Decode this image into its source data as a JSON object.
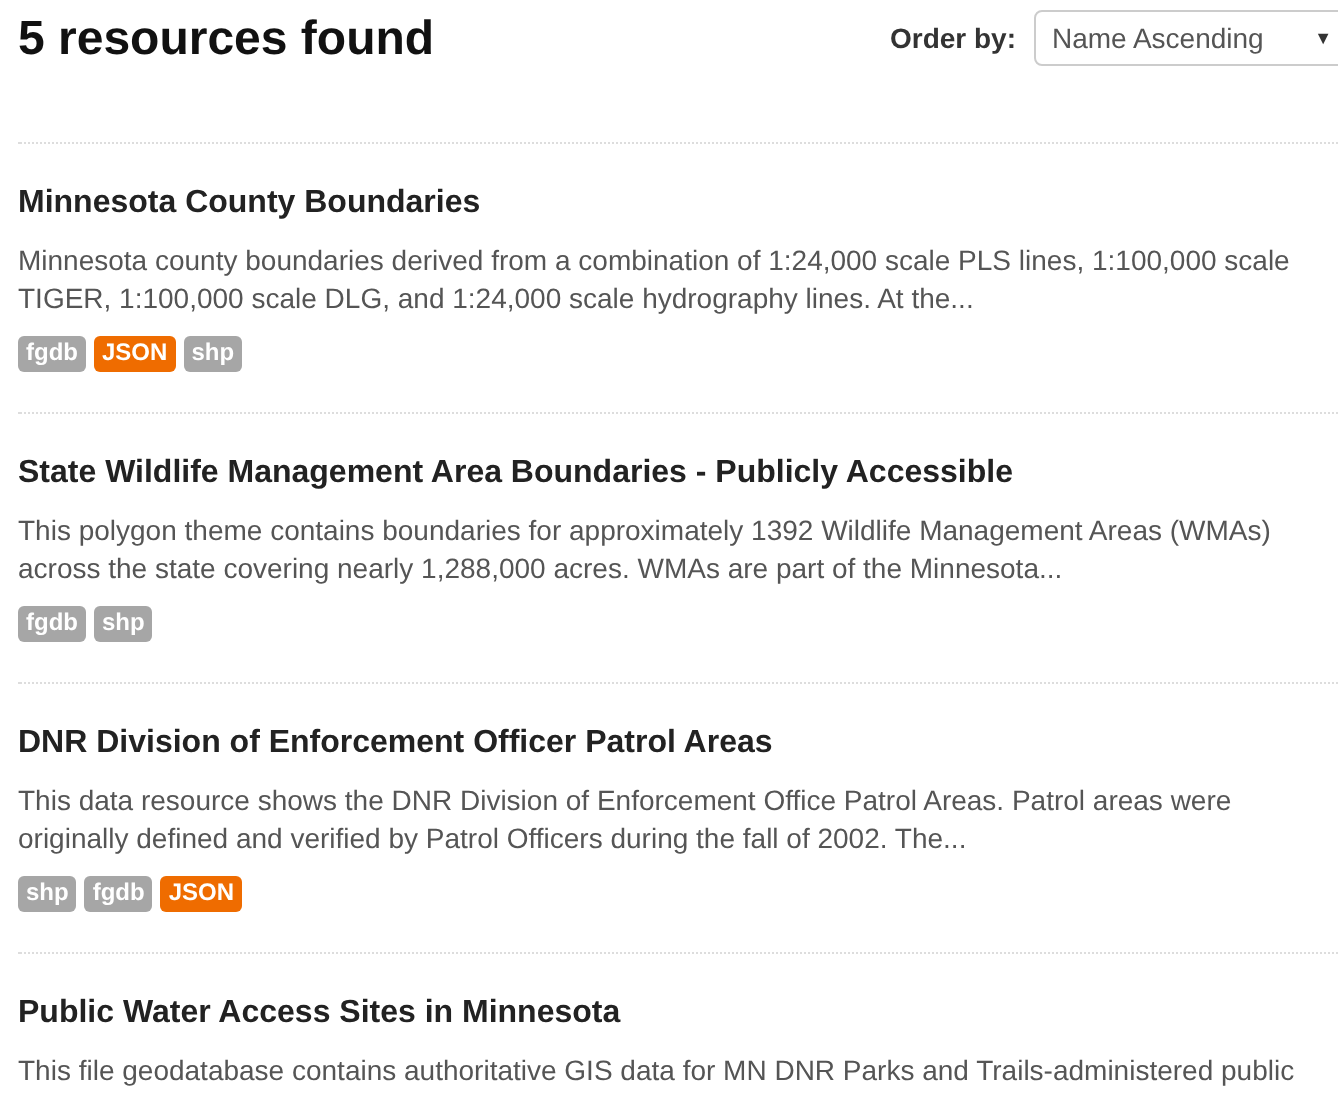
{
  "heading": "5 resources found",
  "order": {
    "label": "Order by:",
    "value": "Name Ascending",
    "arrow": "▼"
  },
  "resources": [
    {
      "title": "Minnesota County Boundaries",
      "description": "Minnesota county boundaries derived from a combination of 1:24,000 scale PLS lines, 1:100,000 scale TIGER, 1:100,000 scale DLG, and 1:24,000 scale hydrography lines. At the...",
      "tags": [
        {
          "label": "fgdb",
          "kind": "plain"
        },
        {
          "label": "JSON",
          "kind": "json"
        },
        {
          "label": "shp",
          "kind": "plain"
        }
      ]
    },
    {
      "title": "State Wildlife Management Area Boundaries - Publicly Accessible",
      "description": "This polygon theme contains boundaries for approximately 1392 Wildlife Management Areas (WMAs) across the state covering nearly 1,288,000 acres. WMAs are part of the Minnesota...",
      "tags": [
        {
          "label": "fgdb",
          "kind": "plain"
        },
        {
          "label": "shp",
          "kind": "plain"
        }
      ]
    },
    {
      "title": "DNR Division of Enforcement Officer Patrol Areas",
      "description": "This data resource shows the DNR Division of Enforcement Office Patrol Areas. Patrol areas were originally defined and verified by Patrol Officers during the fall of 2002. The...",
      "tags": [
        {
          "label": "shp",
          "kind": "plain"
        },
        {
          "label": "fgdb",
          "kind": "plain"
        },
        {
          "label": "JSON",
          "kind": "json"
        }
      ]
    },
    {
      "title": "Public Water Access Sites in Minnesota",
      "description": "This file geodatabase contains authoritative GIS data for MN DNR Parks and Trails-administered public"
    }
  ]
}
